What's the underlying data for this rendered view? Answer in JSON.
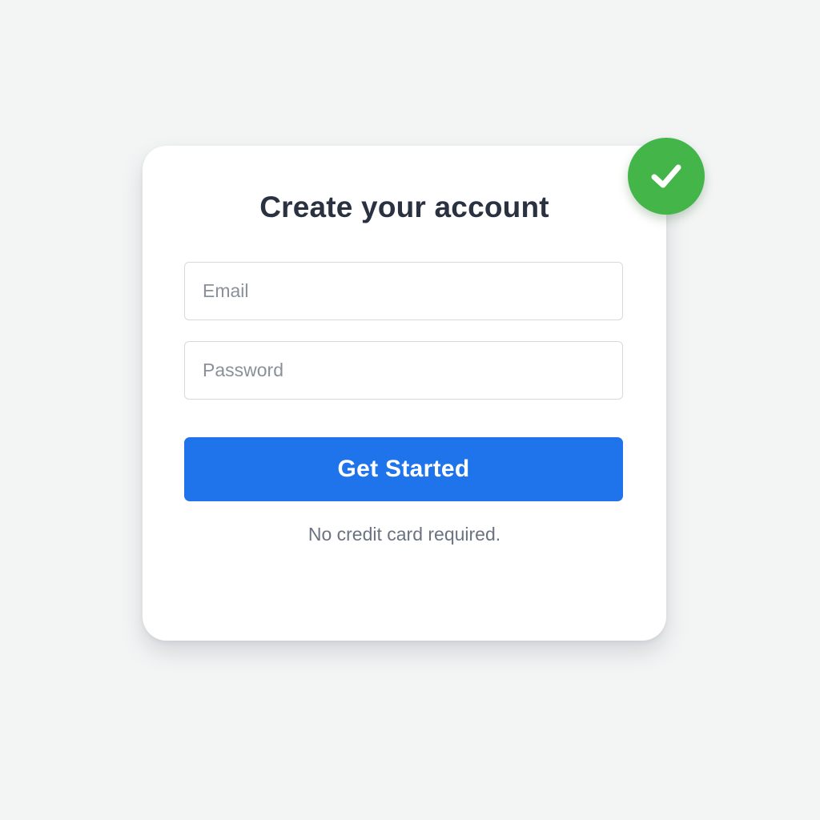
{
  "form": {
    "title": "Create your account",
    "email": {
      "placeholder": "Email",
      "value": ""
    },
    "password": {
      "placeholder": "Password",
      "value": ""
    },
    "submit_label": "Get Started",
    "note": "No credit card required."
  },
  "badge": {
    "icon": "checkmark-icon",
    "color": "#44b548"
  },
  "colors": {
    "accent": "#1f74eb",
    "background": "#f3f5f5",
    "card": "#ffffff",
    "title_text": "#2a3140",
    "muted_text": "#6b7280",
    "success": "#44b548"
  }
}
